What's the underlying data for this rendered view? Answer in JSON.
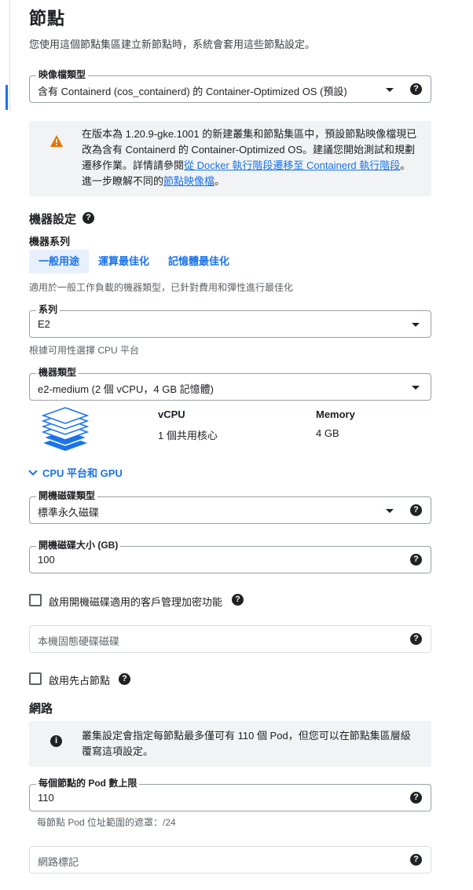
{
  "page": {
    "title": "節點",
    "description": "您使用這個節點集區建立新節點時，系統會套用這些節點設定。"
  },
  "image_type": {
    "label": "映像檔類型",
    "value": "含有 Containerd (cos_containerd) 的 Container-Optimized OS (預設)"
  },
  "warning_banner": {
    "line1": "在版本為 1.20.9-gke.1001 的新建叢集和節點集區中，預設節點映像檔現已",
    "line2": "改為含有 Containerd 的 Container-Optimized OS。建議您開始測試和規劃",
    "line3_prefix": "遷移作業。詳情請參閱",
    "line3_link": "從 Docker 執行階段遷移至 Containerd 執行階段",
    "line3_suffix": "。",
    "line4_prefix": "進一步瞭解不同的",
    "line4_link": "節點映像檔",
    "line4_suffix": "。"
  },
  "machine_config": {
    "title": "機器設定",
    "family_label": "機器系列",
    "tabs": [
      "一般用途",
      "運算最佳化",
      "記憶體最佳化"
    ],
    "tab_description": "適用於一般工作負載的機器類型，已針對費用和彈性進行最佳化",
    "series": {
      "label": "系列",
      "value": "E2"
    },
    "series_hint": "根據可用性選擇 CPU 平台",
    "machine_type": {
      "label": "機器類型",
      "value": "e2-medium (2 個 vCPU，4 GB 記憶體)"
    },
    "spec_headers": {
      "vcpu": "vCPU",
      "memory": "Memory"
    },
    "spec_values": {
      "vcpu": "1 個共用核心",
      "memory": "4 GB"
    },
    "cpu_gpu_toggle": "CPU 平台和 GPU"
  },
  "boot_disk": {
    "type": {
      "label": "開機磁碟類型",
      "value": "標準永久磁碟"
    },
    "size": {
      "label": "開機磁碟大小 (GB)",
      "value": "100"
    },
    "cmek_checkbox": "啟用開機磁碟適用的客戶管理加密功能",
    "local_ssd_placeholder": "本機固態硬碟磁碟"
  },
  "preemptible_checkbox": "啟用先占節點",
  "networking": {
    "title": "網路",
    "info_line1": "叢集設定會指定每節點最多僅可有 110 個 Pod，但您可以在節點集區層級",
    "info_line2": "覆寫這項設定。",
    "max_pods": {
      "label": "每個節點的 Pod 數上限",
      "value": "110"
    },
    "max_pods_hint": "每節點 Pod 位址範圍的遮罩：/24",
    "tags_placeholder": "網路標記"
  },
  "icons": {
    "help": "?",
    "info": "i",
    "warning": "!"
  },
  "colors": {
    "accent": "#1a73e8",
    "warning": "#e37400",
    "stack_blue": "#1a73e8"
  }
}
